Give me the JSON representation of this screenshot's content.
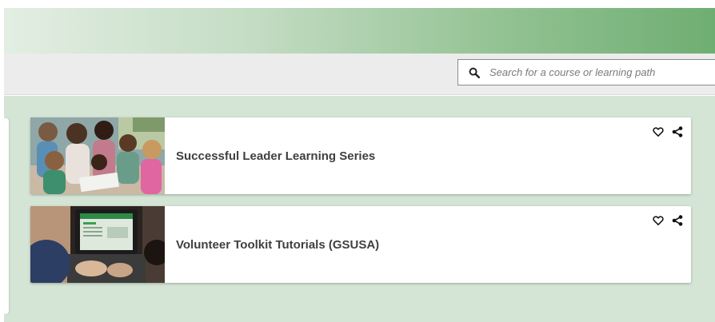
{
  "search": {
    "placeholder": "Search for a course or learning path",
    "icon": "search-icon"
  },
  "courses": [
    {
      "title": "Successful Leader Learning Series",
      "thumbnail": "girls-reading-photo",
      "icons": [
        "heart-icon",
        "share-icon"
      ]
    },
    {
      "title": "Volunteer Toolkit Tutorials (GSUSA)",
      "thumbnail": "laptop-photo",
      "icons": [
        "heart-icon",
        "share-icon"
      ]
    }
  ],
  "colors": {
    "banner_start": "#e3eee3",
    "banner_end": "#6fae72",
    "content_bg": "#d5e5d5",
    "toolbar_bg": "#ececec"
  }
}
